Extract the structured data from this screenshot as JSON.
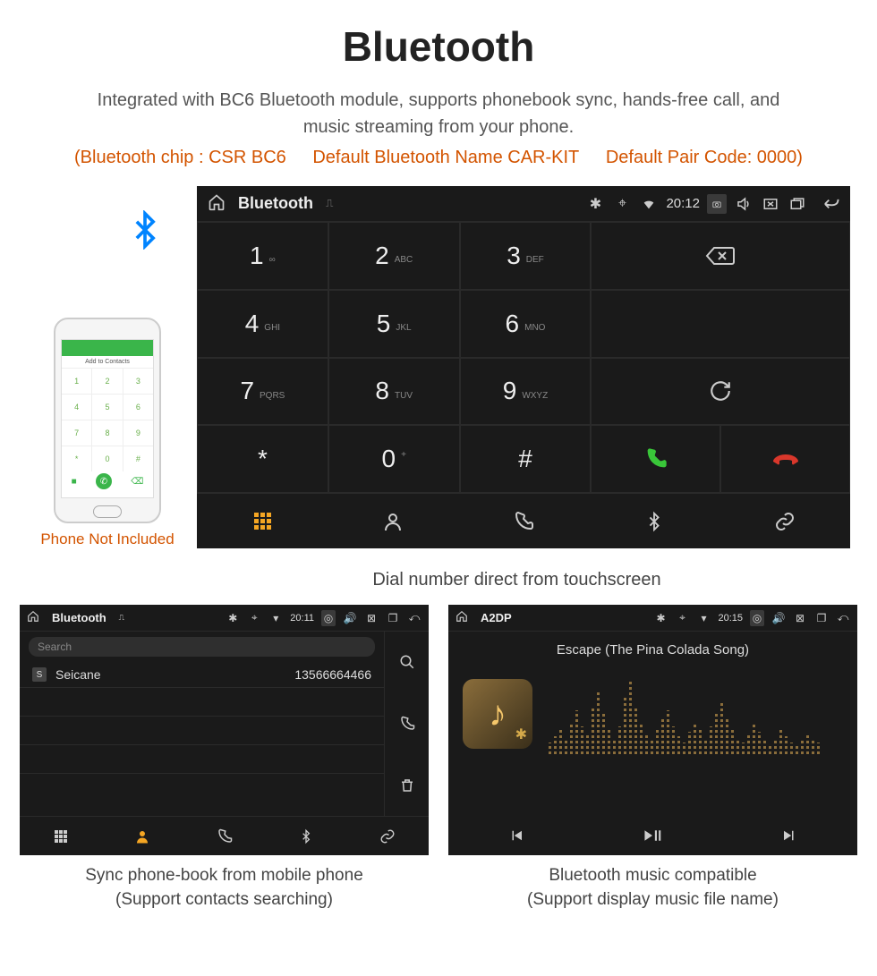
{
  "header": {
    "title": "Bluetooth",
    "subtitle": "Integrated with BC6 Bluetooth module, supports phonebook sync, hands-free call, and music streaming from your phone.",
    "spec_chip": "(Bluetooth chip : CSR BC6",
    "spec_name": "Default Bluetooth Name CAR-KIT",
    "spec_code": "Default Pair Code: 0000)"
  },
  "phone": {
    "topbar": "Add to Contacts",
    "note": "Phone Not Included",
    "keys": [
      "1",
      "2",
      "3",
      "4",
      "5",
      "6",
      "7",
      "8",
      "9",
      "*",
      "0",
      "#"
    ]
  },
  "main_screen": {
    "statusbar": {
      "title": "Bluetooth",
      "time": "20:12"
    },
    "keys": [
      {
        "n": "1",
        "s": "∞"
      },
      {
        "n": "2",
        "s": "ABC"
      },
      {
        "n": "3",
        "s": "DEF"
      },
      {
        "n": "4",
        "s": "GHI"
      },
      {
        "n": "5",
        "s": "JKL"
      },
      {
        "n": "6",
        "s": "MNO"
      },
      {
        "n": "7",
        "s": "PQRS"
      },
      {
        "n": "8",
        "s": "TUV"
      },
      {
        "n": "9",
        "s": "WXYZ"
      },
      {
        "n": "*",
        "s": ""
      },
      {
        "n": "0",
        "s": "+",
        "sup": true
      },
      {
        "n": "#",
        "s": ""
      }
    ],
    "caption": "Dial number direct from touchscreen"
  },
  "contacts": {
    "statusbar": {
      "title": "Bluetooth",
      "time": "20:11"
    },
    "search": "Search",
    "rows": [
      {
        "badge": "S",
        "name": "Seicane",
        "number": "13566664466"
      }
    ],
    "caption_l1": "Sync phone-book from mobile phone",
    "caption_l2": "(Support contacts searching)"
  },
  "music": {
    "statusbar": {
      "title": "A2DP",
      "time": "20:15"
    },
    "song": "Escape (The Pina Colada Song)",
    "caption_l1": "Bluetooth music compatible",
    "caption_l2": "(Support display music file name)"
  }
}
